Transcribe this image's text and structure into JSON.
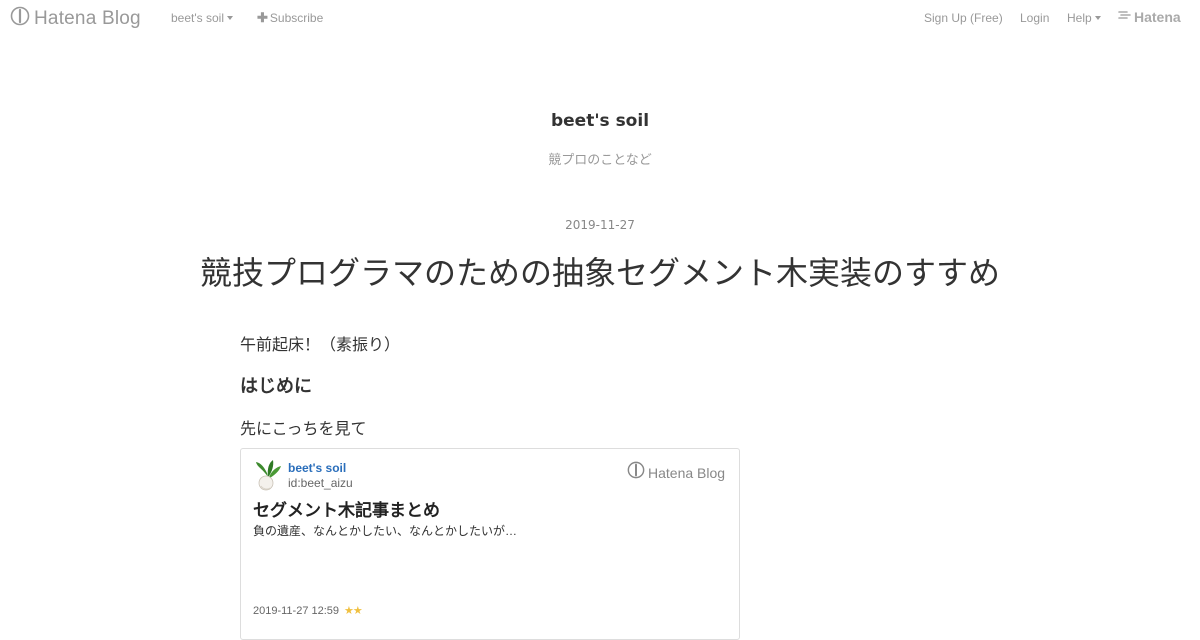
{
  "nav": {
    "brand": "Hatena Blog",
    "blog_menu": "beet's soil",
    "subscribe": "Subscribe",
    "signup": "Sign Up (Free)",
    "login": "Login",
    "help": "Help",
    "hatena": "Hatena"
  },
  "header": {
    "title": "beet's soil",
    "description": "競プロのことなど"
  },
  "article": {
    "date": "2019-11-27",
    "title": "競技プログラマのための抽象セグメント木実装のすすめ",
    "intro": "午前起床！（素振り）",
    "heading": "はじめに",
    "lead": "先にこっちを見て"
  },
  "embed": {
    "blog_name": "beet's soil",
    "user_id": "id:beet_aizu",
    "service": "Hatena Blog",
    "title": "セグメント木記事まとめ",
    "description": "負の遺産、なんとかしたい、なんとかしたいが…",
    "timestamp": "2019-11-27 12:59",
    "stars": "★★"
  },
  "colors": {
    "link": "#2a6ebb",
    "star": "#f0c040",
    "muted": "#999999",
    "text": "#333333"
  },
  "icons": [
    "hatena-blog-logo-icon",
    "caret-down-icon",
    "plus-icon",
    "hatena-logo-icon",
    "beet-avatar-icon",
    "star-icon"
  ]
}
